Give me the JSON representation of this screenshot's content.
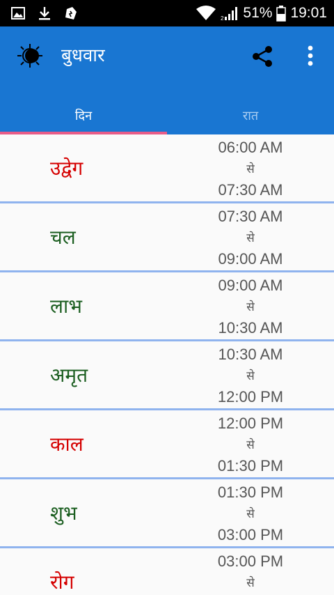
{
  "status_bar": {
    "battery": "51%",
    "time": "19:01",
    "icons": [
      "gallery-icon",
      "download-icon",
      "notification-icon",
      "wifi-icon",
      "signal-icon",
      "battery-icon"
    ]
  },
  "appbar": {
    "title": "बुधवार",
    "icons": [
      "sun-icon",
      "share-icon",
      "more-vert-icon"
    ]
  },
  "tabs": [
    {
      "label": "दिन",
      "active": true
    },
    {
      "label": "रात",
      "active": false
    }
  ],
  "colors": {
    "primary": "#1976d2",
    "indicator": "#e85c88",
    "bad": "#d50000",
    "good": "#1b5e20",
    "divider": "#8fb3ee"
  },
  "rows": [
    {
      "name": "उद्वेग",
      "start": "06:00 AM",
      "sep": "से",
      "end": "07:30 AM",
      "color": "#d50000"
    },
    {
      "name": "चल",
      "start": "07:30 AM",
      "sep": "से",
      "end": "09:00 AM",
      "color": "#1b5e20"
    },
    {
      "name": "लाभ",
      "start": "09:00 AM",
      "sep": "से",
      "end": "10:30 AM",
      "color": "#1b5e20"
    },
    {
      "name": "अमृत",
      "start": "10:30 AM",
      "sep": "से",
      "end": "12:00 PM",
      "color": "#1b5e20"
    },
    {
      "name": "काल",
      "start": "12:00 PM",
      "sep": "से",
      "end": "01:30 PM",
      "color": "#d50000"
    },
    {
      "name": "शुभ",
      "start": "01:30 PM",
      "sep": "से",
      "end": "03:00 PM",
      "color": "#1b5e20"
    },
    {
      "name": "रोग",
      "start": "03:00 PM",
      "sep": "से",
      "end": "",
      "color": "#d50000"
    }
  ]
}
